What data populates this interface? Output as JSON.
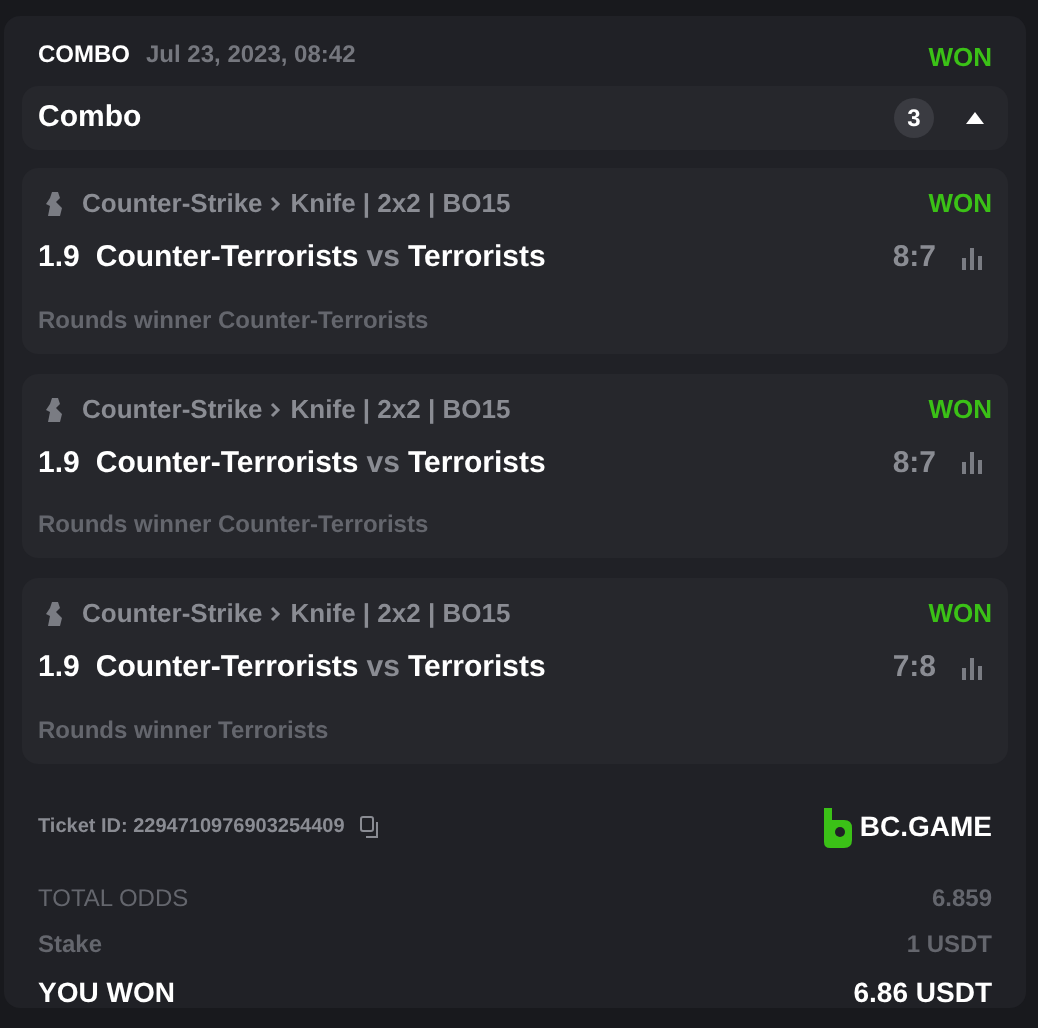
{
  "header": {
    "type": "COMBO",
    "date": "Jul 23, 2023, 08:42",
    "status": "WON"
  },
  "combo": {
    "title": "Combo",
    "count": "3",
    "expanded": true
  },
  "bets": [
    {
      "sport": "Counter-Strike",
      "event": "Knife | 2x2 | BO15",
      "status": "WON",
      "odds": "1.9",
      "home": "Counter-Terrorists",
      "vs": "vs",
      "away": "Terrorists",
      "score": "8:7",
      "market": "Rounds winner Counter-Terrorists"
    },
    {
      "sport": "Counter-Strike",
      "event": "Knife | 2x2 | BO15",
      "status": "WON",
      "odds": "1.9",
      "home": "Counter-Terrorists",
      "vs": "vs",
      "away": "Terrorists",
      "score": "8:7",
      "market": "Rounds winner Counter-Terrorists"
    },
    {
      "sport": "Counter-Strike",
      "event": "Knife | 2x2 | BO15",
      "status": "WON",
      "odds": "1.9",
      "home": "Counter-Terrorists",
      "vs": "vs",
      "away": "Terrorists",
      "score": "7:8",
      "market": "Rounds winner Terrorists"
    }
  ],
  "ticket": {
    "label": "Ticket ID: 2294710976903254409",
    "brand": "BC.GAME"
  },
  "totals": [
    {
      "kind": "muted",
      "label": "TOTAL ODDS",
      "value": "6.859"
    },
    {
      "kind": "muted",
      "label": "Stake",
      "value": "1 USDT"
    },
    {
      "kind": "strong",
      "label": "YOU WON",
      "value": "6.86 USDT"
    }
  ]
}
